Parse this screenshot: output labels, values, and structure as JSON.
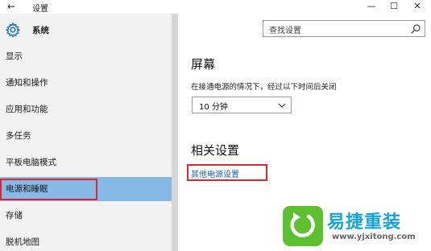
{
  "window": {
    "title": "设置",
    "back_glyph": "←",
    "minimize_glyph": "—",
    "maximize_glyph": "☐",
    "close_glyph": "✕"
  },
  "sidebar": {
    "header_label": "系统",
    "header_icon": "gear-icon",
    "items": [
      {
        "label": "显示"
      },
      {
        "label": "通知和操作"
      },
      {
        "label": "应用和功能"
      },
      {
        "label": "多任务"
      },
      {
        "label": "平板电脑模式"
      },
      {
        "label": "电源和睡眠",
        "selected": true
      },
      {
        "label": "存储"
      },
      {
        "label": "脱机地图"
      }
    ]
  },
  "search": {
    "placeholder": "查找设置",
    "icon": "search-icon"
  },
  "main": {
    "screen_heading": "屏幕",
    "screen_description": "在接通电源的情况下，经过以下时间后关闭",
    "screen_timeout_value": "10 分钟",
    "related_heading": "相关设置",
    "related_link": "其他电源设置"
  },
  "watermark": {
    "name": "易捷重装",
    "url": "www.yjxitong.com"
  },
  "colors": {
    "selected_bg": "#86b9e6",
    "sidebar_bg": "#f2f2f2",
    "link": "#1c5fb8",
    "highlight_box": "#e0262e",
    "watermark_green": "#5cc12e",
    "watermark_blue": "#18a3d8"
  }
}
